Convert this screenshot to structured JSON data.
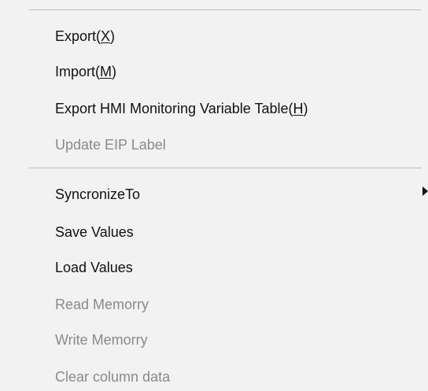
{
  "menu": {
    "items": [
      {
        "base": "Export",
        "mnemonic": "X",
        "enabled": true
      },
      {
        "base": "Import",
        "mnemonic": "M",
        "enabled": true
      },
      {
        "base": "Export HMI Monitoring Variable Table",
        "mnemonic": "H",
        "enabled": true
      },
      {
        "label": "Update EIP Label",
        "enabled": false
      },
      {
        "label": "SyncronizeTo",
        "enabled": true,
        "has_submenu": true,
        "submenu_icon": "chevron-right-icon"
      },
      {
        "label": "Save Values",
        "enabled": true
      },
      {
        "label": "Load Values",
        "enabled": true
      },
      {
        "label": "Read Memorry",
        "enabled": false
      },
      {
        "label": "Write Memorry",
        "enabled": false
      },
      {
        "label": "Clear column data",
        "enabled": false
      }
    ]
  },
  "colors": {
    "background": "#f2f2f2",
    "enabled_text": "#111111",
    "disabled_text": "#8a8a8a",
    "separator": "#bdbdbd"
  }
}
